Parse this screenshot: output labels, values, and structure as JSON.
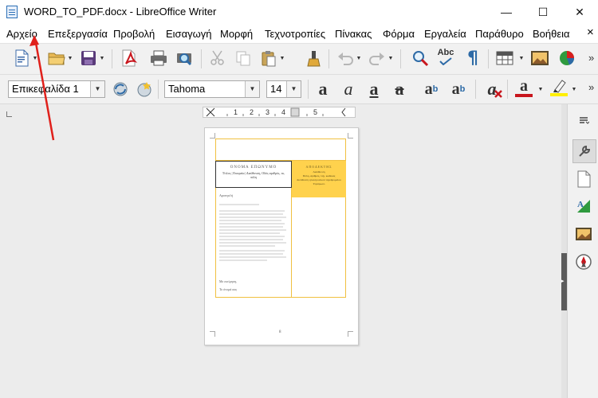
{
  "window": {
    "title": "WORD_TO_PDF.docx - LibreOffice Writer",
    "minimize_glyph": "—",
    "maximize_glyph": "☐",
    "close_glyph": "✕"
  },
  "menu": [
    "Αρχείο",
    "Επεξεργασία",
    "Προβολή",
    "Εισαγωγή",
    "Μορφή",
    "Τεχνοτροπίες",
    "Πίνακας",
    "Φόρμα",
    "Εργαλεία",
    "Παράθυρο",
    "Βοήθεια"
  ],
  "formatting": {
    "paragraph_style": "Επικεφαλίδα 1",
    "font_name": "Tahoma",
    "font_size": "14"
  },
  "ruler": {
    "labels": [
      "1",
      "2",
      "3",
      "4",
      "5"
    ]
  },
  "document": {
    "name_heading": "ΟΝΟΜΑ ΕΠΩΝΥΜΟ",
    "name_subline": "Τίτλος | Εταιρεία | Διεύθυνση, Οδός αριθμός, τκ, πόλη",
    "recipient_heading": "ΑΠΟΔΕΚΤΗΣ",
    "recipient_lines": [
      "Διεύθυνση",
      "Πόλη, αριθμός, ταχ. κώδικας",
      "Διεύθυνση ηλεκτρονικού ταχυδρομείου",
      "Τηλέφωνο"
    ],
    "salutation": "Αγαπητέ/ή",
    "closing": "Με εκτίμηση,",
    "signature": "Το όνομά σας",
    "footer_mark": "8"
  },
  "icons": {
    "toolbar1": [
      "new-document-icon",
      "open-folder-icon",
      "save-icon",
      "export-pdf-icon",
      "print-icon",
      "print-preview-icon",
      "cut-icon",
      "copy-icon",
      "paste-icon",
      "clone-formatting-icon",
      "undo-icon",
      "redo-icon",
      "find-replace-icon",
      "spellcheck-icon",
      "formatting-marks-icon",
      "insert-table-icon",
      "insert-image-icon",
      "insert-chart-icon"
    ],
    "toolbar2": [
      "update-style-icon",
      "new-style-icon",
      "bold-icon",
      "italic-icon",
      "underline-icon",
      "strikethrough-icon",
      "superscript-icon",
      "subscript-icon",
      "clear-formatting-icon",
      "font-color-icon",
      "highlighting-icon"
    ],
    "sidebar": [
      "sidebar-menu-icon",
      "properties-wrench-icon",
      "page-icon",
      "styles-icon",
      "gallery-icon",
      "navigator-compass-icon"
    ]
  },
  "colors": {
    "accent": "#ffd24d",
    "pdf_red": "#c8161d",
    "font_color": "#c8161d",
    "highlight": "#ffef00",
    "arrow": "#e0201b"
  },
  "abc_label": "Abc"
}
